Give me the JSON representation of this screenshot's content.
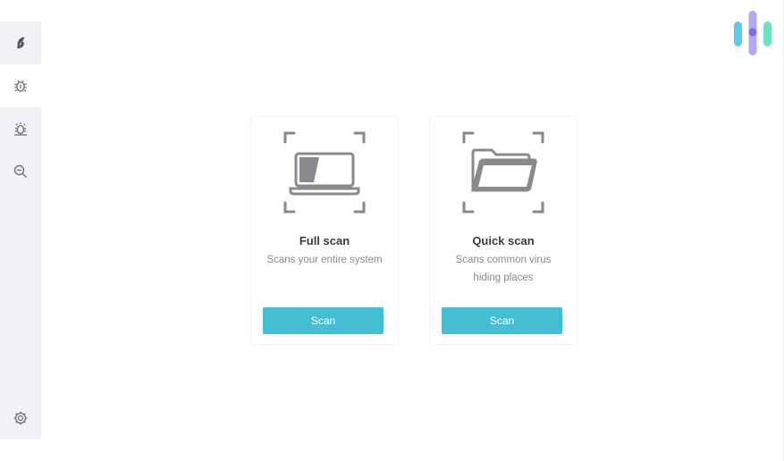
{
  "sidebar": {
    "items": [
      {
        "id": "shield",
        "icon": "surfshark-logo-icon"
      },
      {
        "id": "antivirus",
        "icon": "bug-icon"
      },
      {
        "id": "alert",
        "icon": "bug-alert-icon"
      },
      {
        "id": "search",
        "icon": "zoom-out-icon"
      }
    ],
    "settings_icon": "gear-icon"
  },
  "brand_icon": "brand-logo-icon",
  "cards": [
    {
      "icon": "laptop-icon",
      "title": "Full scan",
      "description": "Scans your entire system",
      "button_label": "Scan"
    },
    {
      "icon": "folder-icon",
      "title": "Quick scan",
      "description": "Scans common virus hiding places",
      "button_label": "Scan"
    }
  ],
  "colors": {
    "accent": "#45bdd3",
    "sidebar_bg": "#f1f1f6",
    "icon_gray": "#8a8a8e",
    "sidebar_icon": "#6e6e75"
  }
}
